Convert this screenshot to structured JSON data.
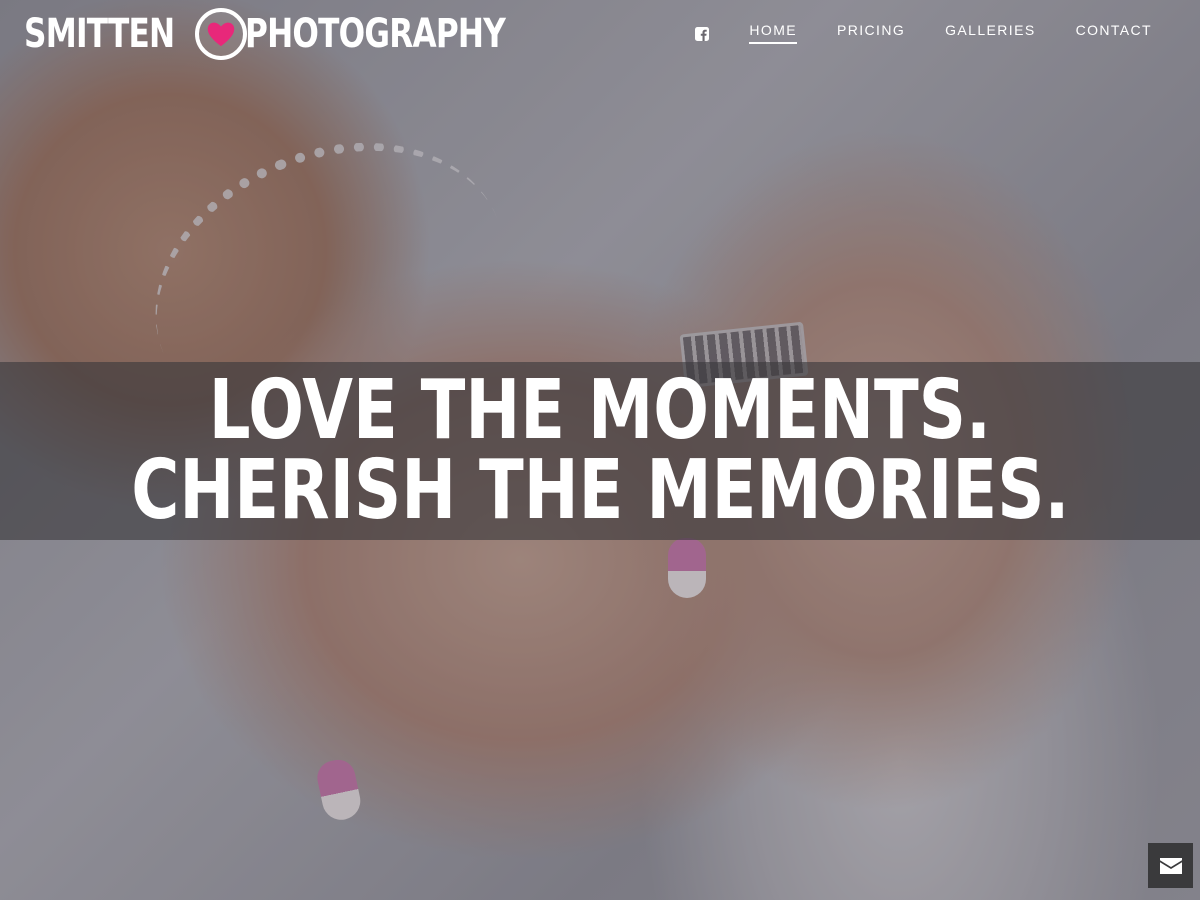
{
  "brand": {
    "word_left": "SMITTEN",
    "word_right": "PHOTOGRAPHY",
    "heart_color": "#e8287a"
  },
  "nav": {
    "social_icon": "facebook-square-icon",
    "items": [
      {
        "label": "HOME",
        "active": true
      },
      {
        "label": "PRICING",
        "active": false
      },
      {
        "label": "GALLERIES",
        "active": false
      },
      {
        "label": "CONTACT",
        "active": false
      }
    ]
  },
  "hero": {
    "line1": "LOVE THE MOMENTS.",
    "line2": "CHERISH THE MEMORIES."
  },
  "contact_button": {
    "icon": "envelope-icon"
  }
}
